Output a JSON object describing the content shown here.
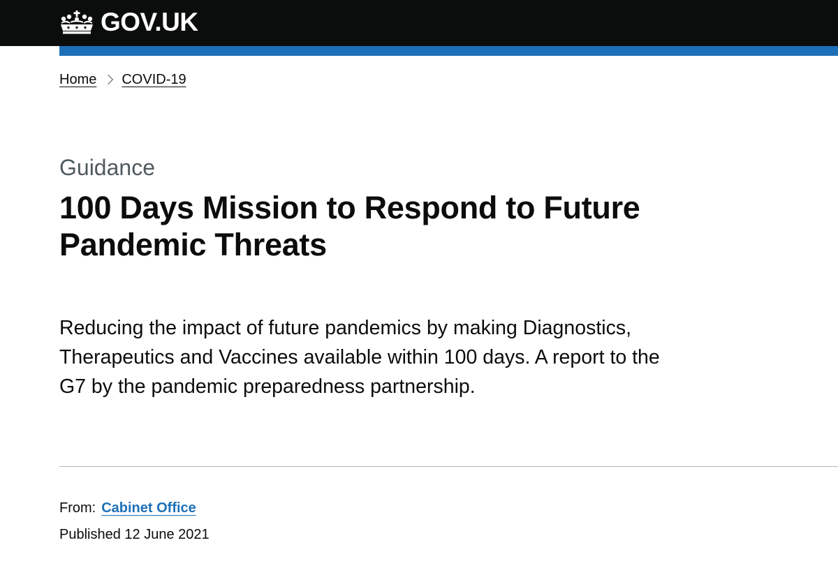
{
  "header": {
    "logo_text": "GOV.UK",
    "logo_icon": "crown-icon",
    "background_color": "#0b0c0c",
    "accent_bar_color": "#1d70b8"
  },
  "breadcrumb": {
    "items": [
      {
        "label": "Home"
      },
      {
        "label": "COVID-19"
      }
    ],
    "separator_icon": "chevron-right-icon"
  },
  "page": {
    "caption": "Guidance",
    "title": "100 Days Mission to Respond to Future Pandemic Threats",
    "lede": "Reducing the impact of future pandemics by making Diagnostics, Therapeutics and Vaccines available within 100 days. A report to the G7 by the pandemic preparedness partnership."
  },
  "metadata": {
    "from_label": "From:",
    "from_org": "Cabinet Office",
    "published_label": "Published",
    "published_date": "12 June 2021",
    "link_color": "#1d70b8"
  }
}
